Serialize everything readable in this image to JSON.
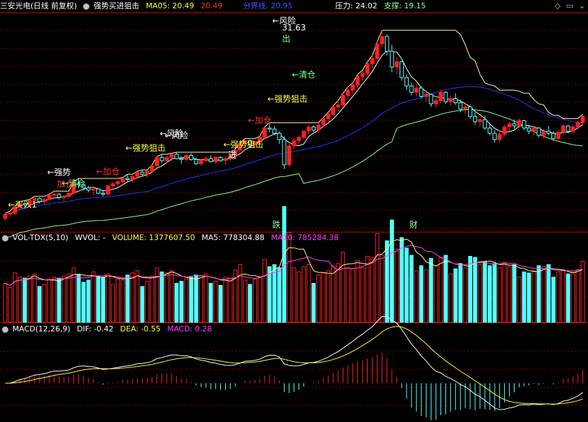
{
  "header": {
    "stock": "三安光电(日线 前复权)",
    "indicator": "强势买进狙击",
    "ma05_label": "MA05: 20.49",
    "ma05_alt": "20.49",
    "divider_label": "分界线: 20.95",
    "pressure": "压力: 24.02",
    "support": "支撑: 19.15"
  },
  "vol_header": {
    "name": "VOL-TDX(5,10)",
    "wvol": "WVOL: -",
    "volume": "VOLUME: 1377607.50",
    "ma5": "MA5: 778304.88",
    "ma10": "MA10: 785284.38"
  },
  "macd_header": {
    "name": "MACD(12,26,9)",
    "dif": "DIF: -0.42",
    "dea": "DEA: -0.55",
    "macd": "MACD: 0.28"
  },
  "colors": {
    "up": "#ff2020",
    "down": "#54ffff",
    "ma5": "#ffffff",
    "ma_mid": "#ffff40",
    "blue_line": "#3030ff",
    "green_line": "#90ff90",
    "magenta": "#ff40ff",
    "grid": "#8b0000"
  },
  "chart_data": {
    "type": "candlestick",
    "price_candles": [
      [
        13.7,
        14.2,
        13.5,
        14.1
      ],
      [
        14.1,
        14.4,
        13.9,
        14.2
      ],
      [
        14.2,
        14.9,
        14.0,
        14.8
      ],
      [
        14.8,
        15.3,
        14.6,
        15.1
      ],
      [
        15.1,
        15.4,
        14.8,
        15.0
      ],
      [
        15.0,
        15.5,
        14.9,
        15.4
      ],
      [
        15.4,
        15.8,
        15.2,
        15.6
      ],
      [
        15.6,
        15.7,
        15.1,
        15.3
      ],
      [
        15.3,
        15.6,
        15.0,
        15.5
      ],
      [
        15.5,
        16.0,
        15.3,
        15.9
      ],
      [
        15.9,
        16.3,
        15.6,
        16.0
      ],
      [
        16.0,
        16.1,
        15.5,
        15.7
      ],
      [
        15.7,
        15.9,
        15.3,
        15.8
      ],
      [
        15.8,
        16.2,
        15.6,
        16.1
      ],
      [
        16.1,
        17.2,
        16.0,
        17.0
      ],
      [
        17.0,
        17.5,
        16.6,
        16.9
      ],
      [
        16.9,
        17.0,
        16.4,
        16.6
      ],
      [
        16.6,
        16.8,
        16.2,
        16.4
      ],
      [
        16.4,
        16.7,
        15.9,
        16.5
      ],
      [
        16.5,
        16.6,
        16.0,
        16.1
      ],
      [
        16.1,
        16.3,
        15.8,
        16.0
      ],
      [
        16.0,
        16.9,
        15.9,
        16.8
      ],
      [
        16.8,
        17.2,
        16.6,
        17.0
      ],
      [
        17.0,
        17.4,
        16.7,
        17.2
      ],
      [
        17.2,
        17.6,
        17.0,
        17.5
      ],
      [
        17.5,
        17.9,
        17.2,
        17.4
      ],
      [
        17.4,
        17.8,
        17.1,
        17.7
      ],
      [
        17.7,
        18.2,
        17.5,
        18.1
      ],
      [
        18.1,
        18.3,
        17.7,
        17.9
      ],
      [
        17.9,
        18.3,
        17.6,
        18.2
      ],
      [
        18.2,
        18.8,
        18.0,
        18.7
      ],
      [
        18.7,
        19.6,
        18.6,
        19.5
      ],
      [
        19.5,
        19.8,
        19.0,
        19.2
      ],
      [
        19.2,
        19.6,
        18.9,
        19.5
      ],
      [
        19.5,
        19.9,
        19.2,
        19.8
      ],
      [
        19.8,
        20.0,
        19.3,
        19.4
      ],
      [
        19.4,
        19.6,
        18.9,
        19.3
      ],
      [
        19.3,
        19.8,
        19.1,
        19.7
      ],
      [
        19.7,
        19.9,
        19.2,
        19.3
      ],
      [
        19.3,
        19.5,
        18.8,
        18.9
      ],
      [
        18.9,
        19.3,
        18.7,
        19.2
      ],
      [
        19.2,
        19.6,
        19.0,
        19.4
      ],
      [
        19.4,
        19.7,
        19.0,
        19.1
      ],
      [
        19.1,
        19.6,
        18.9,
        19.5
      ],
      [
        19.5,
        19.6,
        19.1,
        19.2
      ],
      [
        19.2,
        19.5,
        18.8,
        19.4
      ],
      [
        19.4,
        19.8,
        19.2,
        19.7
      ],
      [
        19.7,
        20.3,
        19.5,
        20.2
      ],
      [
        20.2,
        20.9,
        20.0,
        20.8
      ],
      [
        20.8,
        21.3,
        20.5,
        21.1
      ],
      [
        21.1,
        21.2,
        20.6,
        20.7
      ],
      [
        20.7,
        21.1,
        20.4,
        21.0
      ],
      [
        21.0,
        21.5,
        20.8,
        21.4
      ],
      [
        21.4,
        22.4,
        21.2,
        22.3
      ],
      [
        22.3,
        22.8,
        21.9,
        22.2
      ],
      [
        22.2,
        22.5,
        21.6,
        21.8
      ],
      [
        21.8,
        22.0,
        20.8,
        21.2
      ],
      [
        21.2,
        21.5,
        18.4,
        18.8
      ],
      [
        18.8,
        20.8,
        18.6,
        20.6
      ],
      [
        20.6,
        21.3,
        20.3,
        21.1
      ],
      [
        21.1,
        21.6,
        20.8,
        21.4
      ],
      [
        21.4,
        22.1,
        21.2,
        22.0
      ],
      [
        22.0,
        22.6,
        21.7,
        22.4
      ],
      [
        22.4,
        22.6,
        21.9,
        22.1
      ],
      [
        22.1,
        22.7,
        21.8,
        22.6
      ],
      [
        22.6,
        23.3,
        22.4,
        23.2
      ],
      [
        23.2,
        23.8,
        22.9,
        23.6
      ],
      [
        23.6,
        24.4,
        23.4,
        24.3
      ],
      [
        24.3,
        24.9,
        23.9,
        24.5
      ],
      [
        24.5,
        25.6,
        24.3,
        25.4
      ],
      [
        25.4,
        26.2,
        25.0,
        25.9
      ],
      [
        25.9,
        26.6,
        25.5,
        26.4
      ],
      [
        26.4,
        27.4,
        26.1,
        27.2
      ],
      [
        27.2,
        27.8,
        26.8,
        27.5
      ],
      [
        27.5,
        28.6,
        27.3,
        28.4
      ],
      [
        28.4,
        29.2,
        28.0,
        28.9
      ],
      [
        28.9,
        30.5,
        28.6,
        30.3
      ],
      [
        30.3,
        31.6,
        30.0,
        31.0
      ],
      [
        31.0,
        31.2,
        29.2,
        29.6
      ],
      [
        29.6,
        30.2,
        27.6,
        28.1
      ],
      [
        28.1,
        29.0,
        27.4,
        28.6
      ],
      [
        28.6,
        28.7,
        26.8,
        27.1
      ],
      [
        27.1,
        27.4,
        25.9,
        26.3
      ],
      [
        26.3,
        26.6,
        25.4,
        25.7
      ],
      [
        25.7,
        26.4,
        25.3,
        26.1
      ],
      [
        26.1,
        26.3,
        25.1,
        25.3
      ],
      [
        25.3,
        25.8,
        24.8,
        25.5
      ],
      [
        25.5,
        25.6,
        24.3,
        24.6
      ],
      [
        24.6,
        25.2,
        24.2,
        24.9
      ],
      [
        24.9,
        25.9,
        24.7,
        25.7
      ],
      [
        25.7,
        25.8,
        24.6,
        24.8
      ],
      [
        24.8,
        25.4,
        24.4,
        25.1
      ],
      [
        25.1,
        25.6,
        24.5,
        24.7
      ],
      [
        24.7,
        25.0,
        23.8,
        24.1
      ],
      [
        24.1,
        24.6,
        23.6,
        24.3
      ],
      [
        24.3,
        24.5,
        23.2,
        23.4
      ],
      [
        23.4,
        23.8,
        22.6,
        22.9
      ],
      [
        22.9,
        23.3,
        22.4,
        23.1
      ],
      [
        23.1,
        23.5,
        22.1,
        22.3
      ],
      [
        22.3,
        22.8,
        21.6,
        21.8
      ],
      [
        21.8,
        22.1,
        20.9,
        21.2
      ],
      [
        21.2,
        21.9,
        20.9,
        21.7
      ],
      [
        21.7,
        22.6,
        21.5,
        22.4
      ],
      [
        22.4,
        22.9,
        22.0,
        22.7
      ],
      [
        22.7,
        23.1,
        22.2,
        22.5
      ],
      [
        22.5,
        23.2,
        22.3,
        23.0
      ],
      [
        23.0,
        23.1,
        22.1,
        22.3
      ],
      [
        22.3,
        22.6,
        21.7,
        22.0
      ],
      [
        22.0,
        22.5,
        21.6,
        22.3
      ],
      [
        22.3,
        22.4,
        21.4,
        21.6
      ],
      [
        21.6,
        22.2,
        21.3,
        22.0
      ],
      [
        22.0,
        22.5,
        21.6,
        21.8
      ],
      [
        21.8,
        22.0,
        21.1,
        21.3
      ],
      [
        21.3,
        22.1,
        21.1,
        21.9
      ],
      [
        21.9,
        22.7,
        21.7,
        22.5
      ],
      [
        22.5,
        22.6,
        21.8,
        22.0
      ],
      [
        22.0,
        22.6,
        21.8,
        22.4
      ],
      [
        22.4,
        23.0,
        22.2,
        22.8
      ],
      [
        22.8,
        23.6,
        22.6,
        23.4
      ]
    ],
    "annotations": [
      "←风险",
      "31.63",
      "出",
      "←清仓",
      "←强势狙击",
      "←加仓",
      "←风险",
      "←强势狙击",
      "进",
      "←加仓",
      "←强势狙击",
      "←风险",
      "←强势",
      "加仓",
      "←清仓",
      "←买入1",
      "跌",
      "财"
    ],
    "price_range": [
      12.5,
      32.5
    ],
    "volume_range": [
      0,
      2200000
    ],
    "macd_range": [
      -1.3,
      1.7
    ]
  }
}
